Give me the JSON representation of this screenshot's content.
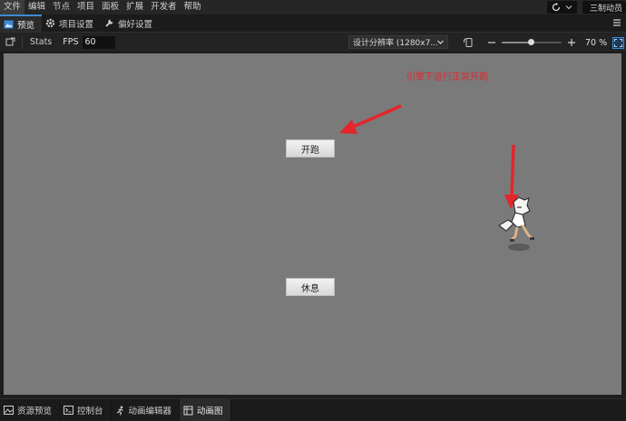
{
  "menu": {
    "items": [
      "文件",
      "编辑",
      "节点",
      "项目",
      "面板",
      "扩展",
      "开发者",
      "帮助"
    ],
    "user_label": "三制动员"
  },
  "tabs": [
    {
      "label": "预览",
      "icon": "preview-icon",
      "active": true
    },
    {
      "label": "项目设置",
      "icon": "gear-icon",
      "active": false
    },
    {
      "label": "偏好设置",
      "icon": "wrench-icon",
      "active": false
    }
  ],
  "toolbar": {
    "stats_label": "Stats",
    "fps_label": "FPS",
    "fps_value": "60",
    "resolution_label": "设计分辨率 (1280x7...",
    "zoom_value": "70 %",
    "zoom_level": 0.48
  },
  "scene": {
    "run_button_label": "开跑",
    "rest_button_label": "休息",
    "annotation": "引擎下运行正常开跑"
  },
  "bottom_tabs": [
    {
      "label": "资源预览",
      "icon": "asset-preview-icon",
      "active": false
    },
    {
      "label": "控制台",
      "icon": "console-icon",
      "active": false
    },
    {
      "label": "动画编辑器",
      "icon": "running-figure-icon",
      "active": false
    },
    {
      "label": "动画图",
      "icon": "animation-graph-icon",
      "active": true
    }
  ],
  "colors": {
    "accent": "#3d8ad6",
    "annotation_red": "#e3262b",
    "canvas_bg": "#7a7a7a"
  }
}
